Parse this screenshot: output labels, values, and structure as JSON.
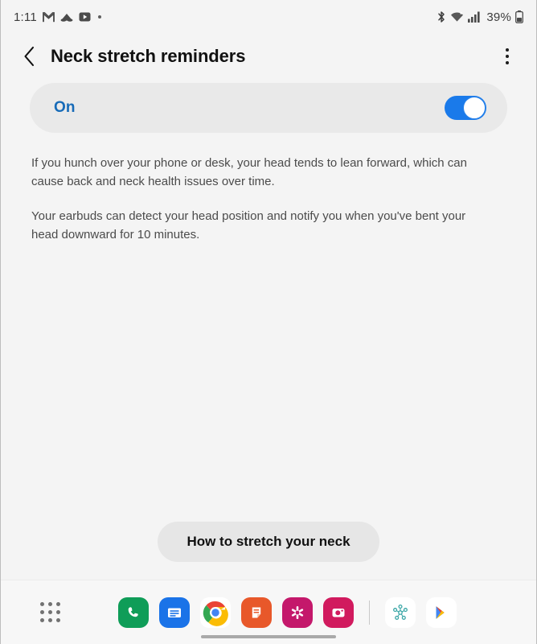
{
  "status_bar": {
    "time": "1:11",
    "left_icons": [
      {
        "name": "gmail-icon",
        "label": "M"
      },
      {
        "name": "cloud-icon",
        "label": "cloud"
      },
      {
        "name": "youtube-icon",
        "label": "play"
      },
      {
        "name": "notification-dot",
        "label": "dot"
      }
    ],
    "right_icons": [
      {
        "name": "bluetooth-icon",
        "label": "bluetooth"
      },
      {
        "name": "wifi-icon",
        "label": "wifi"
      },
      {
        "name": "signal-icon",
        "label": "signal"
      }
    ],
    "battery_percent": "39%"
  },
  "app_bar": {
    "back_label": "Back",
    "title": "Neck stretch reminders",
    "overflow_label": "More options"
  },
  "toggle_card": {
    "state_label": "On",
    "enabled": true,
    "accent_color": "#1a7aea",
    "label_color": "#176bb8"
  },
  "description": {
    "paragraph_1": "If you hunch over your phone or desk, your head tends to lean forward, which can cause back and neck health issues over time.",
    "paragraph_2": "Your earbuds can detect your head position and notify you when you've bent your head downward for 10 minutes."
  },
  "cta": {
    "label": "How to stretch your neck"
  },
  "dock": {
    "apps_button_label": "Apps",
    "apps": [
      {
        "name": "phone-app-icon",
        "label": "Phone"
      },
      {
        "name": "messages-app-icon",
        "label": "Messages"
      },
      {
        "name": "chrome-app-icon",
        "label": "Chrome"
      },
      {
        "name": "keep-app-icon",
        "label": "Keep Notes"
      },
      {
        "name": "flower-app-icon",
        "label": "Flo"
      },
      {
        "name": "camera-app-icon",
        "label": "Camera"
      },
      {
        "name": "smartthings-app-icon",
        "label": "SmartThings"
      },
      {
        "name": "play-store-app-icon",
        "label": "Play Store"
      }
    ],
    "home_indicator_label": "Home"
  }
}
